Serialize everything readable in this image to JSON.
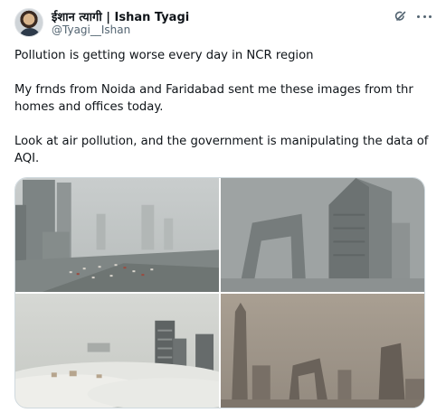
{
  "author": {
    "display_name": "ईशान त्यागी | Ishan Tyagi",
    "handle": "@Tyagi__Ishan",
    "avatar_icon": "avatar-photo"
  },
  "header": {
    "grok_icon": "grok-icon",
    "more_icon": "more-horizontal-icon"
  },
  "tweet": {
    "paragraphs": [
      "Pollution is getting worse every day in NCR region",
      "My frnds from Noida and Faridabad sent me these images from thr homes and offices today.",
      "Look at air pollution, and the government is manipulating the data of AQI."
    ]
  },
  "media": [
    {
      "subject": "smoggy city skyline with highway traffic"
    },
    {
      "subject": "loop-shaped tower in thick grey smog"
    },
    {
      "subject": "high-rise buildings above dense fog"
    },
    {
      "subject": "skyline in brown dust haze"
    }
  ],
  "colors": {
    "text_primary": "#0f1419",
    "text_secondary": "#536471",
    "border": "#cfd9de"
  }
}
